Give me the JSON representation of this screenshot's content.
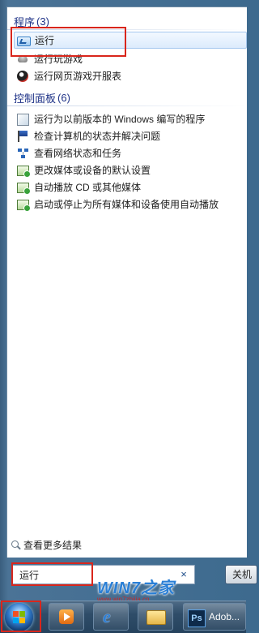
{
  "programs": {
    "header": "程序",
    "count": "(3)",
    "items": [
      {
        "label": "运行",
        "icon": "run-icon"
      },
      {
        "label": "运行玩游戏",
        "icon": "game-icon"
      },
      {
        "label": "运行网页游戏开服表",
        "icon": "web-game-icon"
      }
    ]
  },
  "control_panel": {
    "header": "控制面板",
    "count": "(6)",
    "items": [
      {
        "label": "运行为以前版本的 Windows 编写的程序",
        "icon": "compatibility-icon"
      },
      {
        "label": "检查计算机的状态并解决问题",
        "icon": "action-center-flag-icon"
      },
      {
        "label": "查看网络状态和任务",
        "icon": "network-icon"
      },
      {
        "label": "更改媒体或设备的默认设置",
        "icon": "autoplay-icon"
      },
      {
        "label": "自动播放 CD 或其他媒体",
        "icon": "autoplay-icon"
      },
      {
        "label": "启动或停止为所有媒体和设备使用自动播放",
        "icon": "autoplay-icon"
      }
    ]
  },
  "footer": {
    "see_more": "查看更多结果",
    "search_value": "运行",
    "clear": "×",
    "shutdown": "关机"
  },
  "watermark": {
    "logo": "WIN7之家",
    "url": "www.win7zhijia.cn"
  },
  "taskbar": {
    "active_app_label": "Adob..."
  },
  "colors": {
    "highlight": "#d9261c",
    "group_header": "#1e3287",
    "taskbar": "#2f4d69"
  }
}
